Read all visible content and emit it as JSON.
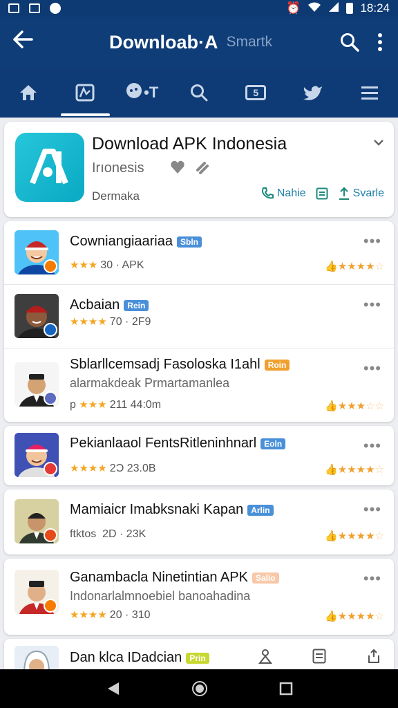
{
  "status": {
    "time": "18:24"
  },
  "appbar": {
    "title": "Downloab·A",
    "subtitle": "Smartk"
  },
  "tabs": [
    {
      "name": "home",
      "glyph": ""
    },
    {
      "name": "apps",
      "glyph": ""
    },
    {
      "name": "games",
      "glyph": "•T"
    },
    {
      "name": "search",
      "glyph": ""
    },
    {
      "name": "updates",
      "glyph": "5"
    },
    {
      "name": "twitter",
      "glyph": ""
    },
    {
      "name": "menu",
      "glyph": ""
    }
  ],
  "header": {
    "title": "Download APK Indonesia",
    "subtitle": "Irıonesis",
    "meta": "Dermaka",
    "actions": [
      {
        "icon": "phone-icon",
        "label": "Nahie"
      },
      {
        "icon": "document-icon",
        "label": ""
      },
      {
        "icon": "share-icon",
        "label": "Svarle"
      }
    ]
  },
  "apps": [
    {
      "name": "Cowniangiaariaa",
      "tag": "Sbln",
      "tag_color": "#4a90d9",
      "meta_stars": "★★★",
      "meta": "30 · APK",
      "rating": 4.5,
      "avatar_bg": "#4fc3f7",
      "skin": "#f4c8a0",
      "hair": "#c62828",
      "shirt": "#0d47a1",
      "badge": "#f57c00"
    },
    {
      "name": "Acbaian",
      "tag": "Rein",
      "tag_color": "#4aa0d0",
      "meta_stars": "★★★★",
      "meta": "70 · 2F9",
      "rating": null,
      "avatar_bg": "#3e3e3e",
      "skin": "#8d5a3b",
      "hair": "#b71c1c",
      "shirt": "#212121",
      "badge": "#1565c0"
    },
    {
      "name": "Sblarllcemsadj Fasoloska I1ahl",
      "tag": "Roin",
      "tag_color": "#f0a030",
      "line2": "alarmakdeak    Prmartamanlea",
      "meta_stars": "★★★",
      "meta_prefix": "p",
      "meta": "211  44:0m",
      "rating": 3.5,
      "avatar_bg": "#f5f5f5",
      "skin": "#d4a373",
      "hair": "#212121",
      "shirt": "#212121",
      "badge": "#5c6bc0"
    },
    {
      "name": "Pekianlaaol FentsRitleninhnarl",
      "tag": "Eoln",
      "tag_color": "#4a90d9",
      "meta_stars": "★★★★",
      "meta": "2Ɔ   23.0B",
      "rating": 4.5,
      "avatar_bg": "#3f51b5",
      "skin": "#f2c49b",
      "hair": "#e91e63",
      "shirt": "#e0e0e0",
      "badge": "#e53935"
    },
    {
      "name": "Mamiaicr Imabksnaki Kapan",
      "tag": "Arlin",
      "tag_color": "#4aa0d0",
      "meta_stars": "",
      "meta_prefix": "ftktos",
      "meta": "2D · 23K",
      "rating": 4.5,
      "avatar_bg": "#d7d0a0",
      "skin": "#c8946a",
      "hair": "#212121",
      "shirt": "#2e3b2e",
      "badge": "#e64a19"
    },
    {
      "name": "Ganambacla Ninetintian APK",
      "tag": "Salio",
      "tag_color": "#f8c8a8",
      "line2": "Indonarlalmnoebiel  banoahadina",
      "meta_stars": "★★★★",
      "meta": "20 · 310",
      "rating": 4.5,
      "avatar_bg": "#f5f0e8",
      "skin": "#e0b088",
      "hair": "#212121",
      "shirt": "#c62828",
      "badge": "#f57c00"
    },
    {
      "name": "Dan klca IDadcian",
      "tag": "Prin",
      "tag_color": "#c8d832"
    }
  ]
}
